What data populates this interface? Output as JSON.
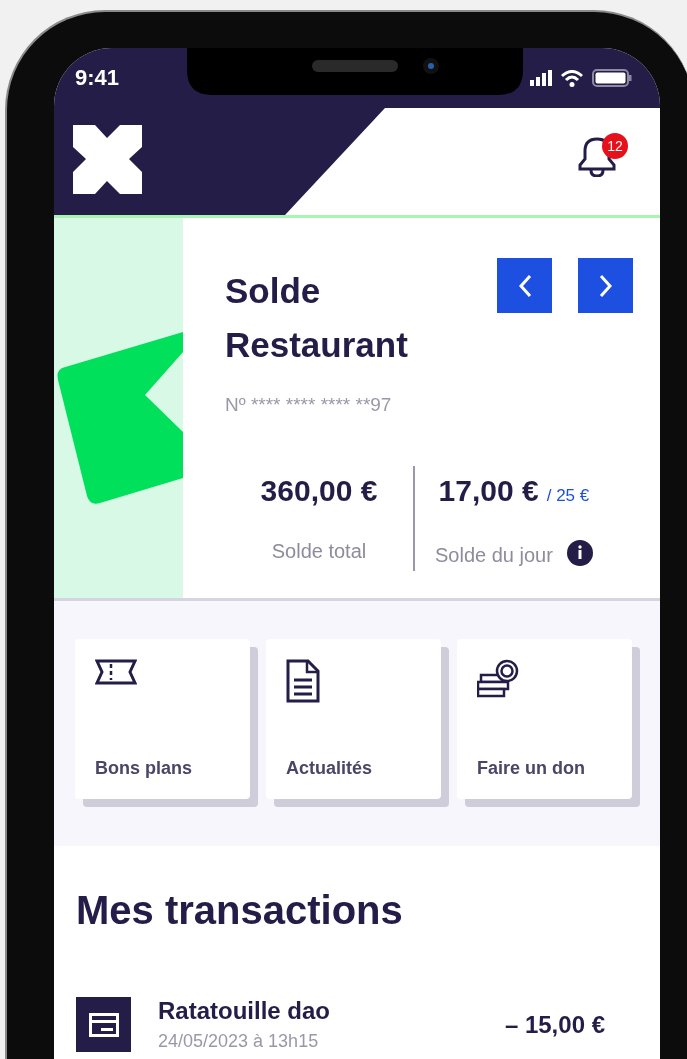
{
  "status_bar": {
    "time": "9:41"
  },
  "header": {
    "notifications": {
      "count": "12"
    }
  },
  "balance_card": {
    "title": "Solde Restaurant",
    "card_number": "Nº **** **** **** **97",
    "total": {
      "amount": "360,00 €",
      "label": "Solde total"
    },
    "daily": {
      "amount": "17,00 €",
      "limit": "/ 25 €",
      "label": "Solde du jour"
    }
  },
  "shortcuts": [
    {
      "label": "Bons plans",
      "kind": "ticket"
    },
    {
      "label": "Actualités",
      "kind": "document"
    },
    {
      "label": "Faire un don",
      "kind": "coins"
    }
  ],
  "transactions": {
    "title": "Mes transactions",
    "items": [
      {
        "merchant": "Ratatouille dao",
        "date": "24/05/2023 à 13h15",
        "amount": "– 15,00 €"
      }
    ]
  }
}
